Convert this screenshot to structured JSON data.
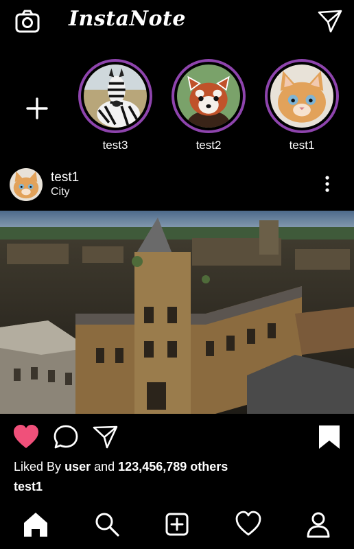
{
  "app": {
    "title": "InstaNote"
  },
  "header": {
    "camera_icon": "camera-icon",
    "send_icon": "paper-plane-icon"
  },
  "stories": {
    "add_icon": "plus-icon",
    "items": [
      {
        "name": "test3",
        "image": "zebra"
      },
      {
        "name": "test2",
        "image": "red-panda"
      },
      {
        "name": "test1",
        "image": "kitten"
      }
    ],
    "ring_color": "#8e44ad"
  },
  "post": {
    "user": "test1",
    "location": "City",
    "image": "aerial view of historic college buildings",
    "liked": true,
    "like_color": "#f0507a",
    "likes_prefix": "Liked By",
    "likes_user": "user",
    "likes_and": "and",
    "likes_count": "123,456,789 others",
    "caption_user": "test1"
  },
  "bottom_nav": [
    "home-icon",
    "search-icon",
    "add-post-icon",
    "heart-icon",
    "profile-icon"
  ]
}
